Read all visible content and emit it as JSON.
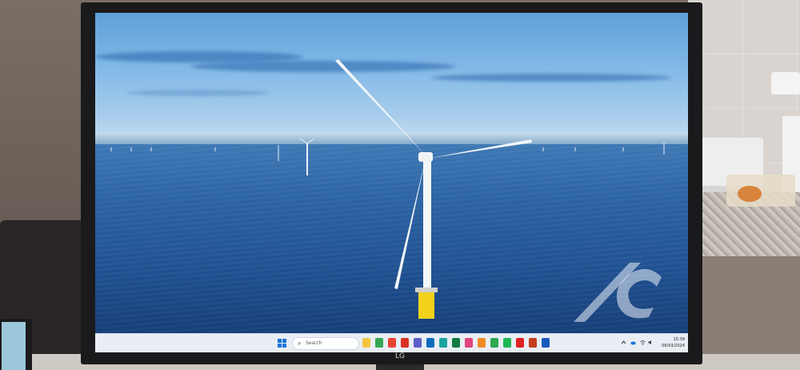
{
  "monitor": {
    "brand_label": "LG"
  },
  "taskbar": {
    "search_placeholder": "Search",
    "clock_time": "15:39",
    "clock_date": "06/03/2024",
    "apps": [
      {
        "name": "file-explorer-icon",
        "color": "#f5c542"
      },
      {
        "name": "browser-icon",
        "color": "#34a853"
      },
      {
        "name": "chrome-icon",
        "color": "#ea4335"
      },
      {
        "name": "mail-icon",
        "color": "#d93025"
      },
      {
        "name": "teams-icon",
        "color": "#5b5fc7"
      },
      {
        "name": "outlook-icon",
        "color": "#0f6cbd"
      },
      {
        "name": "edge-icon",
        "color": "#1aa5a0"
      },
      {
        "name": "excel-icon",
        "color": "#107c41"
      },
      {
        "name": "app-pink-icon",
        "color": "#e0457b"
      },
      {
        "name": "app-orange-icon",
        "color": "#f08a24"
      },
      {
        "name": "app-green-icon",
        "color": "#2fa84f"
      },
      {
        "name": "spotify-icon",
        "color": "#1db954"
      },
      {
        "name": "acrobat-icon",
        "color": "#e02424"
      },
      {
        "name": "powerpoint-icon",
        "color": "#c43e1c"
      },
      {
        "name": "word-icon",
        "color": "#185abd"
      }
    ]
  },
  "colors": {
    "accent": "#1a73d9",
    "sea": "#1f4f8f",
    "sky": "#7fb7e6",
    "bezel": "#1a1a1c"
  }
}
